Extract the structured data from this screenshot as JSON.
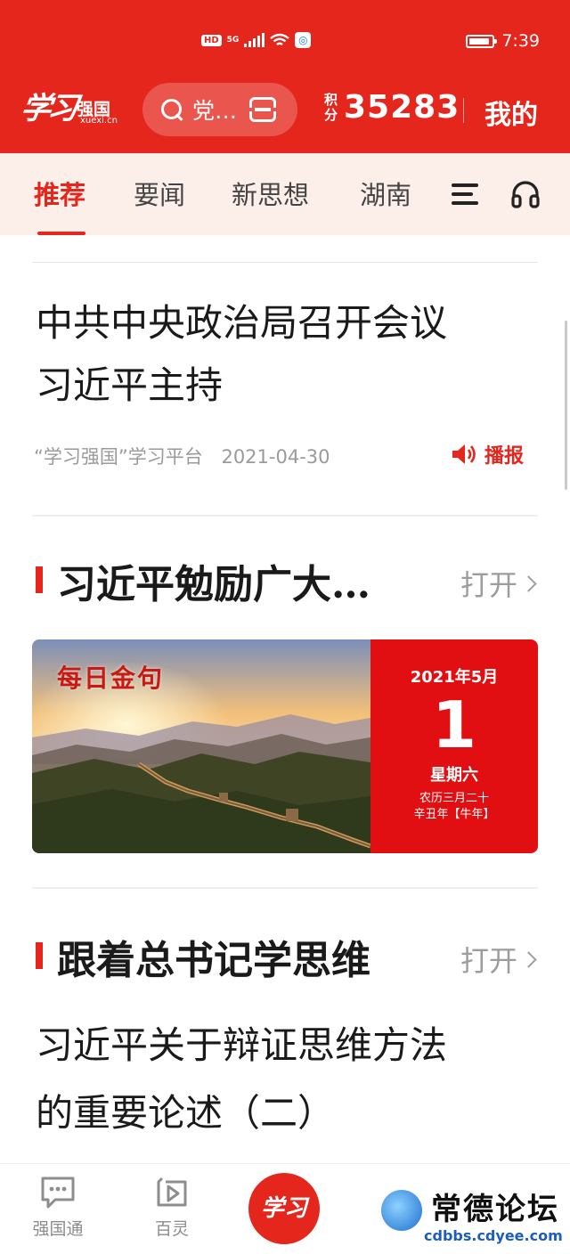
{
  "status_bar": {
    "hd": "HD",
    "network": "5G",
    "time": "7:39"
  },
  "header": {
    "logo_script": "学习",
    "logo_cn": "强国",
    "logo_url": "xuexi.cn",
    "search_text": "党…",
    "points_label": "积分",
    "points_value": "35283",
    "mine_label": "我的"
  },
  "tabs": [
    {
      "label": "推荐",
      "active": true
    },
    {
      "label": "要闻",
      "active": false
    },
    {
      "label": "新思想",
      "active": false
    },
    {
      "label": "湖南",
      "active": false
    }
  ],
  "article": {
    "title_line1": "中共中央政治局召开会议",
    "title_line2": "习近平主持",
    "source": "“学习强国”学习平台",
    "date": "2021-04-30",
    "broadcast_label": "播报"
  },
  "section1": {
    "title": "习近平勉励广大…",
    "open_label": "打开"
  },
  "daily_card": {
    "label": "每日金句",
    "year_month": "2021年5月",
    "day": "1",
    "weekday": "星期六",
    "lunar_line1": "农历三月二十",
    "lunar_line2": "辛丑年【牛年】"
  },
  "section2": {
    "title": "跟着总书记学思维",
    "open_label": "打开",
    "article_line1": "习近平关于辩证思维方法",
    "article_line2": "的重要论述（二）"
  },
  "bottom_nav": {
    "items": [
      {
        "label": "强国通",
        "icon": "chat-bubble-icon"
      },
      {
        "label": "百灵",
        "icon": "play-video-icon"
      },
      {
        "label": "学习",
        "icon": "study-logo-icon"
      }
    ]
  },
  "watermark": {
    "title": "常德论坛",
    "url": "cdbbs.cdyee.com"
  },
  "colors": {
    "brand_red": "#e4261d",
    "tab_bg": "#fcefea",
    "calendar_red": "#e10f12"
  }
}
